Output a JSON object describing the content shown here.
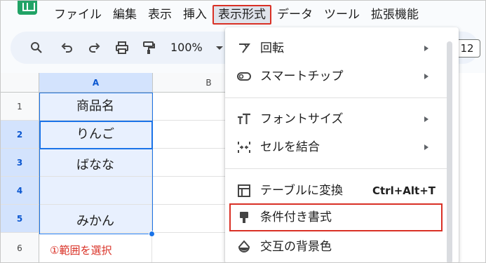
{
  "menubar": {
    "items": [
      "ファイル",
      "編集",
      "表示",
      "挿入",
      "表示形式",
      "データ",
      "ツール",
      "拡張機能"
    ],
    "active_index": 4
  },
  "toolbar": {
    "zoom": "100%",
    "font_size": "12",
    "icons": [
      "search-icon",
      "undo-icon",
      "redo-icon",
      "print-icon",
      "paint-format-icon",
      "chevron-down-icon"
    ]
  },
  "grid": {
    "columns": [
      "A",
      "B"
    ],
    "rows": [
      "1",
      "2",
      "3",
      "4",
      "5",
      "6"
    ],
    "cells": [
      "商品名",
      "りんご",
      "ばなな",
      "",
      "みかん"
    ],
    "annotation": "①範囲を選択"
  },
  "format_menu": {
    "items": [
      {
        "label": "回転",
        "icon": "rotate-icon",
        "submenu": true
      },
      {
        "label": "スマートチップ",
        "icon": "smart-chip-icon",
        "submenu": true
      },
      {
        "label": "フォントサイズ",
        "icon": "font-size-icon",
        "submenu": true
      },
      {
        "label": "セルを結合",
        "icon": "merge-icon",
        "submenu": true
      },
      {
        "label": "テーブルに変換",
        "icon": "table-icon",
        "shortcut": "Ctrl+Alt+T"
      },
      {
        "label": "条件付き書式",
        "icon": "conditional-format-icon",
        "highlighted": true
      },
      {
        "label": "交互の背景色",
        "icon": "fill-color-icon"
      }
    ]
  },
  "colors": {
    "accent": "#1a73e8",
    "highlight_box": "#d93025",
    "selection_fill": "#e8f0fe",
    "header_selected": "#d3e3fd",
    "logo": "#21a366"
  }
}
